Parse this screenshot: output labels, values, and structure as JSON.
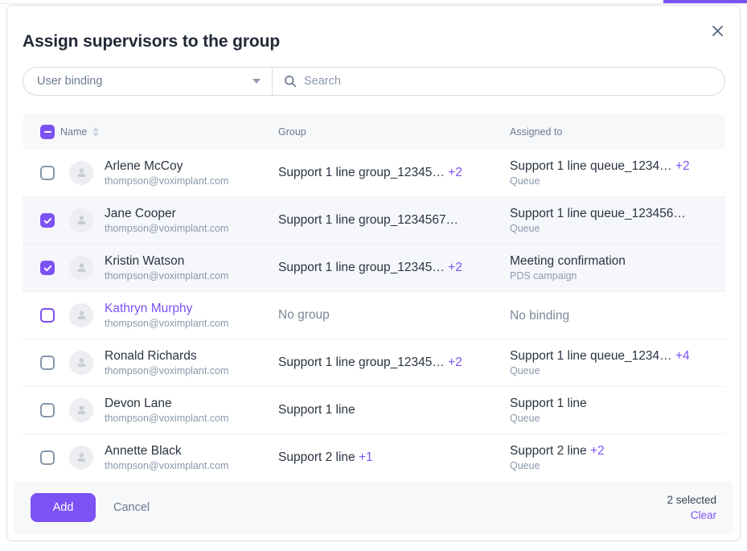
{
  "modal": {
    "title": "Assign supervisors to the group",
    "close_icon": "close-icon"
  },
  "filter": {
    "binding_select_value": "User binding",
    "search_placeholder": "Search",
    "search_value": "",
    "search_icon": "search-icon",
    "caret_icon": "chevron-down-icon"
  },
  "table": {
    "headers": {
      "name": "Name",
      "group": "Group",
      "assigned_to": "Assigned to"
    },
    "header_checkbox_state": "indeterminate",
    "rows": [
      {
        "checked": false,
        "highlighted": false,
        "name": "Arlene McCoy",
        "email": "thompson@voximplant.com",
        "group": "Support 1 line group_12345…",
        "group_plus": "+2",
        "assigned_main": "Support 1 line queue_1234…",
        "assigned_plus": "+2",
        "assigned_sub": "Queue"
      },
      {
        "checked": true,
        "highlighted": false,
        "name": "Jane Cooper",
        "email": "thompson@voximplant.com",
        "group": "Support 1 line group_1234567…",
        "group_plus": "",
        "assigned_main": "Support 1 line queue_123456…",
        "assigned_plus": "",
        "assigned_sub": "Queue"
      },
      {
        "checked": true,
        "highlighted": false,
        "name": "Kristin Watson",
        "email": "thompson@voximplant.com",
        "group": "Support 1 line group_12345…",
        "group_plus": "+2",
        "assigned_main": "Meeting confirmation",
        "assigned_plus": "",
        "assigned_sub": "PDS campaign"
      },
      {
        "checked": false,
        "highlighted": true,
        "name": "Kathryn Murphy",
        "email": "thompson@voximplant.com",
        "group": "No group",
        "group_plus": "",
        "assigned_main": "No binding",
        "assigned_plus": "",
        "assigned_sub": ""
      },
      {
        "checked": false,
        "highlighted": false,
        "name": "Ronald Richards",
        "email": "thompson@voximplant.com",
        "group": "Support 1 line group_12345…",
        "group_plus": "+2",
        "assigned_main": "Support 1 line queue_1234…",
        "assigned_plus": "+4",
        "assigned_sub": "Queue"
      },
      {
        "checked": false,
        "highlighted": false,
        "name": "Devon Lane",
        "email": "thompson@voximplant.com",
        "group": "Support 1 line",
        "group_plus": "",
        "assigned_main": "Support 1 line",
        "assigned_plus": "",
        "assigned_sub": "Queue"
      },
      {
        "checked": false,
        "highlighted": false,
        "name": "Annette Black",
        "email": "thompson@voximplant.com",
        "group": "Support 2 line",
        "group_plus": "+1",
        "assigned_main": "Support 2 line",
        "assigned_plus": "+2",
        "assigned_sub": "Queue"
      }
    ]
  },
  "footer": {
    "add_label": "Add",
    "cancel_label": "Cancel",
    "selected_count_label": "2 selected",
    "clear_label": "Clear"
  },
  "colors": {
    "accent": "#7C52F4",
    "text": "#2b3442",
    "muted": "#8b99ad",
    "row_selected_bg": "#f5f7fb",
    "header_bg": "#f7f8fa"
  }
}
